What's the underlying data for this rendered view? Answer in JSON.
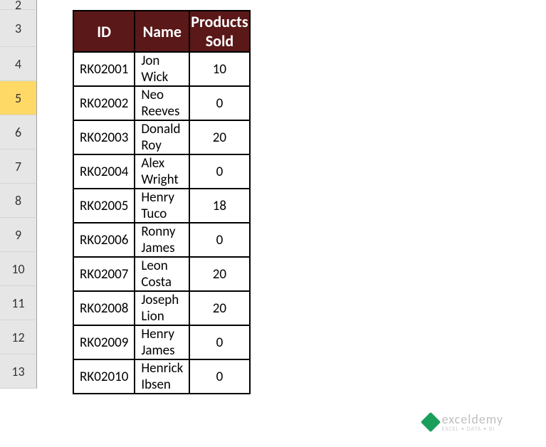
{
  "rowHeaders": [
    "2",
    "3",
    "4",
    "5",
    "6",
    "7",
    "8",
    "9",
    "10",
    "11",
    "12",
    "13"
  ],
  "selectedRow": "5",
  "table": {
    "headers": {
      "id": "ID",
      "name": "Name",
      "sold": "Products Sold"
    },
    "rows": [
      {
        "id": "RK02001",
        "name": "Jon Wick",
        "sold": "10"
      },
      {
        "id": "RK02002",
        "name": "Neo Reeves",
        "sold": "0"
      },
      {
        "id": "RK02003",
        "name": "Donald Roy",
        "sold": "20"
      },
      {
        "id": "RK02004",
        "name": "Alex Wright",
        "sold": "0"
      },
      {
        "id": "RK02005",
        "name": "Henry Tuco",
        "sold": "18"
      },
      {
        "id": "RK02006",
        "name": "Ronny James",
        "sold": "0"
      },
      {
        "id": "RK02007",
        "name": "Leon Costa",
        "sold": "20"
      },
      {
        "id": "RK02008",
        "name": "Joseph Lion",
        "sold": "20"
      },
      {
        "id": "RK02009",
        "name": "Henry James",
        "sold": "0"
      },
      {
        "id": "RK02010",
        "name": "Henrick Ibsen",
        "sold": "0"
      }
    ]
  },
  "watermark": {
    "brand": "exceldemy",
    "tagline": "EXCEL • DATA • BI"
  }
}
